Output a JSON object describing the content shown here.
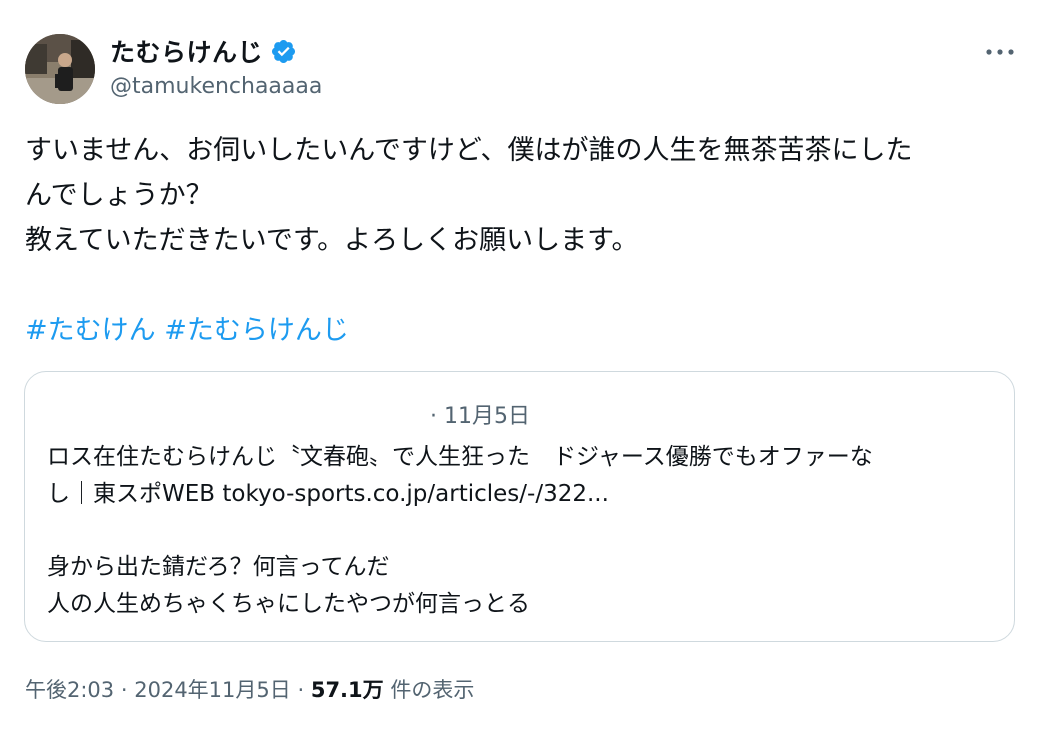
{
  "author": {
    "display_name": "たむらけんじ",
    "handle": "@tamukenchaaaaa",
    "verified_color": "#1d9bf0",
    "avatar_icon": "profile-photo"
  },
  "more_icon": "more-horizontal-icon",
  "tweet": {
    "lines": [
      "すいません、お伺いしたいんですけど、僕はが誰の人生を無茶苦茶にした",
      "んでしょうか？",
      "教えていただきたいです。よろしくお願いします。"
    ],
    "hashtags": [
      "#たむけん",
      "#たむらけんじ"
    ]
  },
  "quote": {
    "separator": "·",
    "date": "11月5日",
    "lines_1": [
      "ロス在住たむらけんじ〝文春砲〟で人生狂った　ドジャース優勝でもオファーな",
      "し｜東スポWEB tokyo-sports.co.jp/articles/-/322..."
    ],
    "lines_2": [
      "身から出た錆だろ？何言ってんだ",
      "人の人生めちゃくちゃにしたやつが何言っとる"
    ]
  },
  "meta": {
    "time": "午後2:03",
    "dot": "·",
    "date": "2024年11月5日",
    "views_count": "57.1万",
    "views_label": "件の表示"
  },
  "colors": {
    "text": "#0f1419",
    "secondary": "#536471",
    "accent": "#1d9bf0",
    "border": "#cfd9de"
  }
}
